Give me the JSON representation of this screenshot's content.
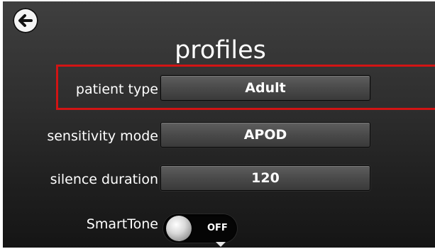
{
  "header": {
    "title": "profiles",
    "back_icon": "back-arrow-icon"
  },
  "settings": [
    {
      "key": "patient_type",
      "label": "patient type",
      "value": "Adult",
      "highlighted": true
    },
    {
      "key": "sensitivity_mode",
      "label": "sensitivity mode",
      "value": "APOD",
      "highlighted": false
    },
    {
      "key": "silence_duration",
      "label": "silence duration",
      "value": "120",
      "highlighted": false
    }
  ],
  "smarttone": {
    "label": "SmartTone",
    "state": "OFF"
  },
  "colors": {
    "highlight": "#d11414",
    "background": "#2f2f2f",
    "text": "#ffffff"
  },
  "icons": {
    "scroll_down": "chevron-down-icon"
  }
}
